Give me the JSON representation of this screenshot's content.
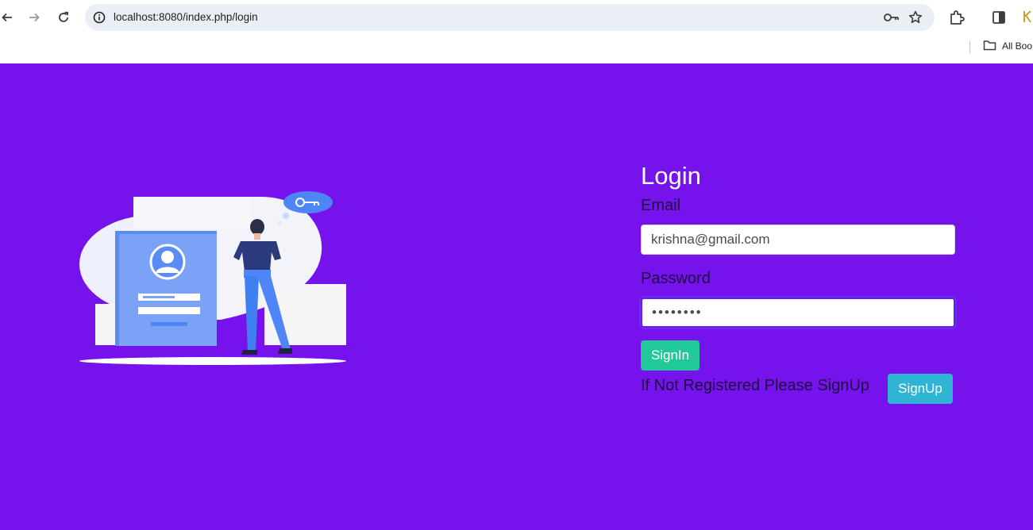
{
  "browser": {
    "url": "localhost:8080/index.php/login",
    "bookmarks_label": "All Boo"
  },
  "login": {
    "title": "Login",
    "email_label": "Email",
    "email_value": "krishna@gmail.com",
    "password_label": "Password",
    "password_value": "password",
    "signin_label": "SignIn",
    "signup_prompt": "If Not Registered Please SignUp",
    "signup_label": "SignUp"
  },
  "colors": {
    "page_background": "#7612eb",
    "signin_button": "#20c997",
    "signup_button": "#2fb4d4"
  },
  "icons": {
    "back": "arrow-left-icon",
    "forward": "arrow-right-icon",
    "reload": "reload-icon",
    "site_info": "info-icon",
    "password_key": "key-icon",
    "bookmark": "star-icon",
    "extensions": "puzzle-icon",
    "side_panel": "side-panel-icon",
    "folder": "folder-icon"
  }
}
